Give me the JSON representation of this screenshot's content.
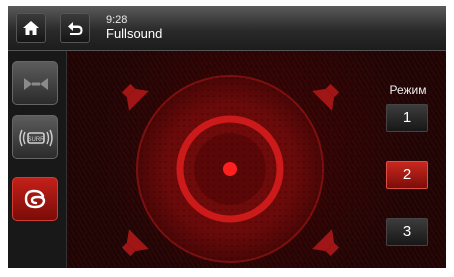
{
  "header": {
    "time": "9:28",
    "title": "Fullsound"
  },
  "icons": {
    "home": "home-icon",
    "back": "back-arrow-icon",
    "balance": "balance-icon",
    "surround": "surround-icon",
    "fullsound": "fullsound-icon",
    "speaker": "speaker-icon"
  },
  "mode": {
    "label": "Режим",
    "options": [
      "1",
      "2",
      "3"
    ],
    "selected": "2"
  },
  "colors": {
    "accent": "#c8281f",
    "background": "#0d0d0d"
  }
}
